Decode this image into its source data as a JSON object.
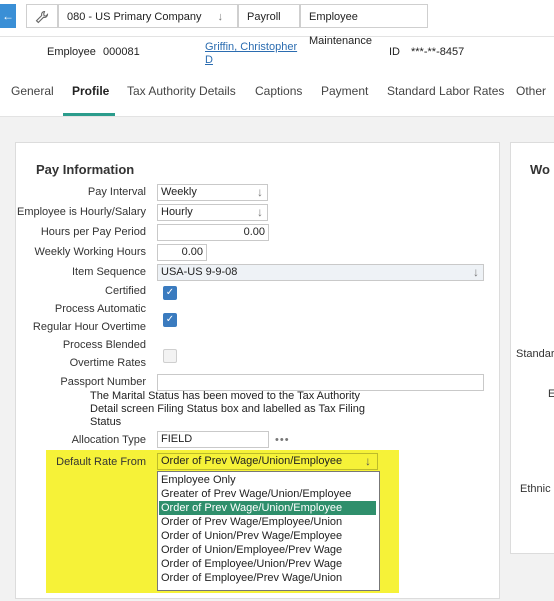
{
  "breadcrumb": {
    "company": "080 - US Primary Company",
    "module": "Payroll",
    "screen": "Employee Maintenance"
  },
  "employee": {
    "label": "Employee",
    "number": "000081",
    "name_line1": "Griffin, Christopher",
    "name_line2": "D",
    "id_label": "ID",
    "id_value": "***-**-8457"
  },
  "tabs": [
    "General",
    "Profile",
    "Tax Authority Details",
    "Captions",
    "Payment",
    "Standard Labor Rates",
    "Other"
  ],
  "pay_info": {
    "title": "Pay Information",
    "pay_interval_label": "Pay Interval",
    "pay_interval_value": "Weekly",
    "hourly_salary_label": "Employee is Hourly/Salary",
    "hourly_salary_value": "Hourly",
    "hours_per_period_label": "Hours per Pay Period",
    "hours_per_period_value": "0.00",
    "weekly_hours_label": "Weekly Working Hours",
    "weekly_hours_value": "0.00",
    "item_sequence_label": "Item Sequence",
    "item_sequence_value": "USA-US 9-9-08",
    "certified_label": "Certified",
    "certified_checked": true,
    "process_auto_label1": "Process Automatic",
    "process_auto_label2": "Regular Hour Overtime",
    "process_auto_checked": true,
    "process_blended_label1": "Process Blended",
    "process_blended_label2": "Overtime Rates",
    "process_blended_checked": false,
    "passport_label": "Passport Number",
    "passport_value": "",
    "marital_note": "The Marital Status has been moved to the Tax Authority Detail screen Filing Status box and labelled as Tax Filing Status",
    "allocation_type_label": "Allocation Type",
    "allocation_type_value": "FIELD",
    "default_rate_label": "Default Rate From",
    "default_rate_value": "Order of Prev Wage/Union/Employee",
    "default_rate_options": [
      "Employee Only",
      "Greater of Prev Wage/Union/Employee",
      "Order of Prev Wage/Union/Employee",
      "Order of Prev Wage/Employee/Union",
      "Order of Union/Prev Wage/Employee",
      "Order of Union/Employee/Prev Wage",
      "Order of Employee/Union/Prev Wage",
      "Order of Employee/Prev Wage/Union"
    ],
    "selected_option_index": 2
  },
  "side_panel": {
    "title": "Wo",
    "label_standar": "Standar",
    "label_e": "E",
    "label_ethnic": "Ethnic"
  },
  "colors": {
    "accent": "#2b9c8c",
    "highlight": "#f6f238",
    "selected_option": "#2f8f6c",
    "checkbox": "#3a7bbf"
  }
}
